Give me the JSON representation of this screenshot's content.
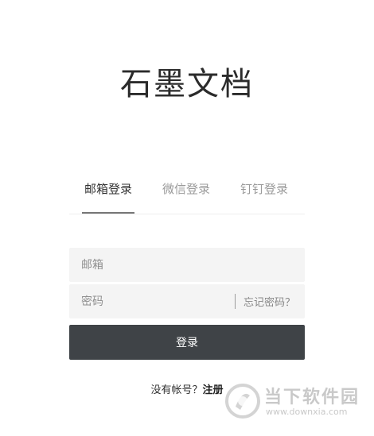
{
  "app": {
    "title": "石墨文档"
  },
  "tabs": [
    {
      "label": "邮箱登录",
      "active": true
    },
    {
      "label": "微信登录",
      "active": false
    },
    {
      "label": "钉钉登录",
      "active": false
    }
  ],
  "form": {
    "email_placeholder": "邮箱",
    "password_placeholder": "密码",
    "forgot_label": "忘记密码？",
    "submit_label": "登录"
  },
  "footer": {
    "prompt": "没有帐号？",
    "register_label": "注册"
  },
  "watermark": {
    "title": "当下软件园",
    "url": "www.downxia.com"
  },
  "colors": {
    "button_bg": "#3f4347",
    "field_bg": "#f4f4f4",
    "active_tab_text": "#333333",
    "inactive_tab_text": "#9a9a9a"
  }
}
